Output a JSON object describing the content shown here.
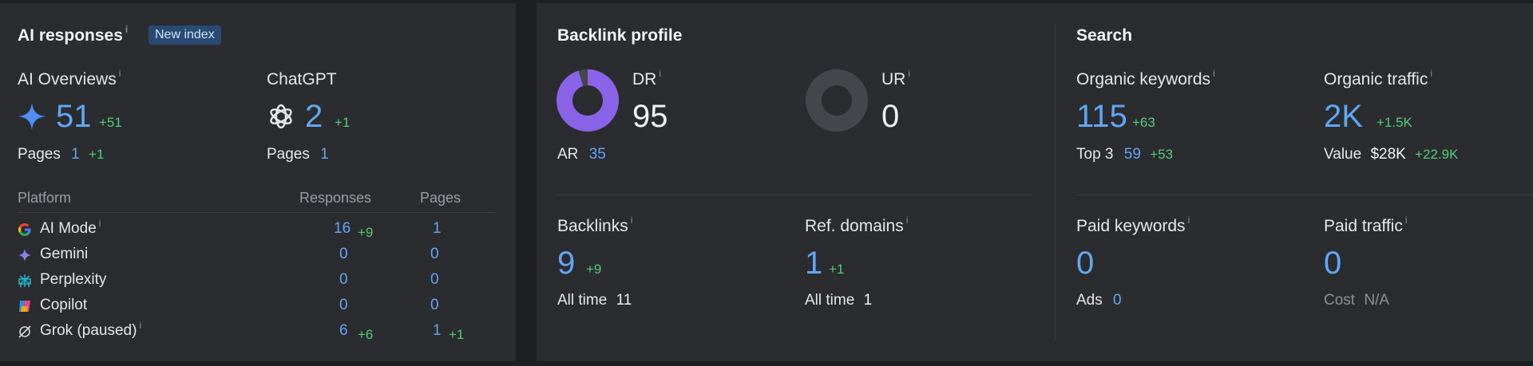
{
  "ai": {
    "title": "AI responses",
    "badge": "New index",
    "overviews": {
      "label": "AI Overviews",
      "value": "51",
      "delta": "+51",
      "pages_label": "Pages",
      "pages_value": "1",
      "pages_delta": "+1"
    },
    "chatgpt": {
      "label": "ChatGPT",
      "value": "2",
      "delta": "+1",
      "pages_label": "Pages",
      "pages_value": "1"
    },
    "table": {
      "col_platform": "Platform",
      "col_responses": "Responses",
      "col_pages": "Pages",
      "rows": [
        {
          "name": "AI Mode",
          "icon": "google-icon",
          "responses": "16",
          "responses_delta": "+9",
          "pages": "1",
          "pages_delta": ""
        },
        {
          "name": "Gemini",
          "icon": "gemini-icon",
          "responses": "0",
          "responses_delta": "",
          "pages": "0",
          "pages_delta": ""
        },
        {
          "name": "Perplexity",
          "icon": "perplexity-icon",
          "responses": "0",
          "responses_delta": "",
          "pages": "0",
          "pages_delta": ""
        },
        {
          "name": "Copilot",
          "icon": "copilot-icon",
          "responses": "0",
          "responses_delta": "",
          "pages": "0",
          "pages_delta": ""
        },
        {
          "name": "Grok (paused)",
          "icon": "grok-icon",
          "responses": "6",
          "responses_delta": "+6",
          "pages": "1",
          "pages_delta": "+1"
        }
      ]
    }
  },
  "backlink": {
    "title": "Backlink profile",
    "dr": {
      "label": "DR",
      "value": "95",
      "fill_fraction": 0.95
    },
    "ar": {
      "label": "AR",
      "value": "35"
    },
    "ur": {
      "label": "UR",
      "value": "0",
      "fill_fraction": 0
    },
    "backlinks": {
      "label": "Backlinks",
      "value": "9",
      "delta": "+9",
      "sub_label": "All time",
      "sub_value": "11"
    },
    "ref_domains": {
      "label": "Ref. domains",
      "value": "1",
      "delta": "+1",
      "sub_label": "All time",
      "sub_value": "1"
    }
  },
  "search": {
    "title": "Search",
    "organic_keywords": {
      "label": "Organic keywords",
      "value": "115",
      "delta": "+63",
      "sub_label": "Top 3",
      "sub_value": "59",
      "sub_delta": "+53"
    },
    "organic_traffic": {
      "label": "Organic traffic",
      "value": "2K",
      "delta": "+1.5K",
      "sub_label": "Value",
      "sub_value": "$28K",
      "sub_delta": "+22.9K"
    },
    "paid_keywords": {
      "label": "Paid keywords",
      "value": "0",
      "sub_label": "Ads",
      "sub_value": "0"
    },
    "paid_traffic": {
      "label": "Paid traffic",
      "value": "0",
      "sub_label": "Cost",
      "sub_value": "N/A"
    }
  },
  "colors": {
    "accent_blue": "#61a7f4",
    "positive_green": "#4fcf76",
    "dr_purple": "#8a63e8",
    "ring_gray": "#45474c"
  },
  "info_glyph": "i"
}
